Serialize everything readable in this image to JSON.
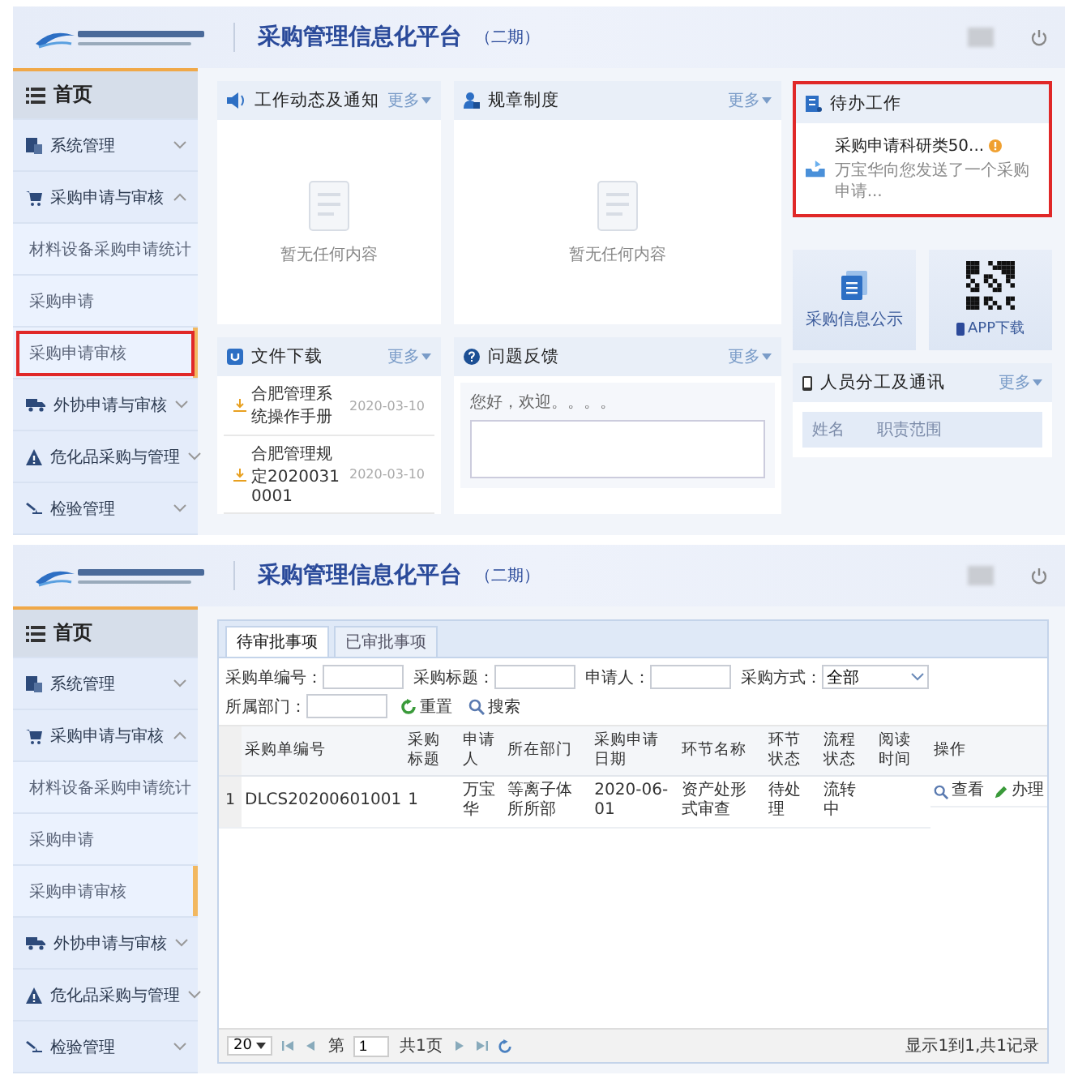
{
  "screens": [
    {
      "kind": "dashboard",
      "header": {
        "title": "采购管理信息化平台",
        "edition": "（二期）"
      },
      "sidebar": [
        {
          "label": "首页",
          "kind": "home",
          "selected": false
        },
        {
          "label": "系统管理",
          "kind": "group",
          "expanded": false,
          "selected": false
        },
        {
          "label": "采购申请与审核",
          "kind": "group",
          "expanded": true,
          "selected": false
        },
        {
          "label": "材料设备采购申请统计",
          "kind": "sub",
          "selected": false
        },
        {
          "label": "采购申请",
          "kind": "sub",
          "selected": false
        },
        {
          "label": "采购申请审核",
          "kind": "sub",
          "selected": true,
          "annotated": true
        },
        {
          "label": "外协申请与审核",
          "kind": "group",
          "expanded": false,
          "selected": false
        },
        {
          "label": "危化品采购与管理",
          "kind": "group",
          "expanded": false,
          "selected": false
        },
        {
          "label": "检验管理",
          "kind": "group",
          "expanded": false,
          "selected": false
        }
      ],
      "dashboard": {
        "notices": {
          "title": "工作动态及通知",
          "more": "更多",
          "empty": "暂无任何内容"
        },
        "rules": {
          "title": "规章制度",
          "more": "更多",
          "empty": "暂无任何内容"
        },
        "todo": {
          "title": "待办工作",
          "annotated": true,
          "items": [
            {
              "title": "采购申请科研类50...",
              "summary": "万宝华向您发送了一个采购申请..."
            }
          ]
        },
        "tiles": [
          {
            "label": "采购信息公示",
            "kind": "notice"
          },
          {
            "label": "APP下载",
            "kind": "app"
          }
        ],
        "downloads": {
          "title": "文件下载",
          "more": "更多",
          "files": [
            {
              "name": "合肥管理系统操作手册",
              "date": "2020-03-10"
            },
            {
              "name": "合肥管理规定20200310001",
              "date": "2020-03-10"
            }
          ]
        },
        "feedback": {
          "title": "问题反馈",
          "more": "更多",
          "greeting": "您好，欢迎。。。。"
        },
        "staff": {
          "title": "人员分工及通讯",
          "more": "更多",
          "columns": [
            "姓名",
            "职责范围"
          ]
        }
      }
    },
    {
      "kind": "approval",
      "header": {
        "title": "采购管理信息化平台",
        "edition": "（二期）"
      },
      "sidebar": [
        {
          "label": "首页",
          "kind": "home",
          "selected": false
        },
        {
          "label": "系统管理",
          "kind": "group",
          "expanded": false,
          "selected": false
        },
        {
          "label": "采购申请与审核",
          "kind": "group",
          "expanded": true,
          "selected": false
        },
        {
          "label": "材料设备采购申请统计",
          "kind": "sub",
          "selected": false
        },
        {
          "label": "采购申请",
          "kind": "sub",
          "selected": false
        },
        {
          "label": "采购申请审核",
          "kind": "sub",
          "selected": true,
          "annotated": false
        },
        {
          "label": "外协申请与审核",
          "kind": "group",
          "expanded": false,
          "selected": false
        },
        {
          "label": "危化品采购与管理",
          "kind": "group",
          "expanded": false,
          "selected": false
        },
        {
          "label": "检验管理",
          "kind": "group",
          "expanded": false,
          "selected": false
        }
      ],
      "approval": {
        "tabs": [
          {
            "label": "待审批事项",
            "selected": true
          },
          {
            "label": "已审批事项",
            "selected": false
          }
        ],
        "filters": [
          {
            "label": "采购单编号：",
            "kind": "text"
          },
          {
            "label": "采购标题：",
            "kind": "text"
          },
          {
            "label": "申请人：",
            "kind": "text"
          },
          {
            "label": "采购方式：",
            "kind": "select",
            "value": "全部"
          },
          {
            "label": "所属部门：",
            "kind": "text"
          }
        ],
        "buttons": [
          {
            "label": "重置",
            "kind": "reset"
          },
          {
            "label": "搜索",
            "kind": "search"
          }
        ],
        "columns": [
          "采购单编号",
          "采购标题",
          "申请人",
          "所在部门",
          "采购申请日期",
          "环节名称",
          "环节状态",
          "流程状态",
          "阅读时间",
          "操作"
        ],
        "rows": [
          {
            "index": "1",
            "order_no": "DLCS20200601001",
            "title": "1",
            "applicant": "万宝华",
            "department": "等离子体所所部",
            "date": "2020-06-01",
            "step": "资产处形式审查",
            "step_status": "待处理",
            "flow_status": "流转中",
            "actions": [
              {
                "label": "查看",
                "kind": "view"
              },
              {
                "label": "办理",
                "kind": "edit"
              }
            ]
          }
        ],
        "pager": {
          "page_size": "20",
          "page_prefix": "第",
          "page": "1",
          "total_pages": "共1页",
          "summary": "显示1到1,共1记录"
        }
      }
    }
  ]
}
